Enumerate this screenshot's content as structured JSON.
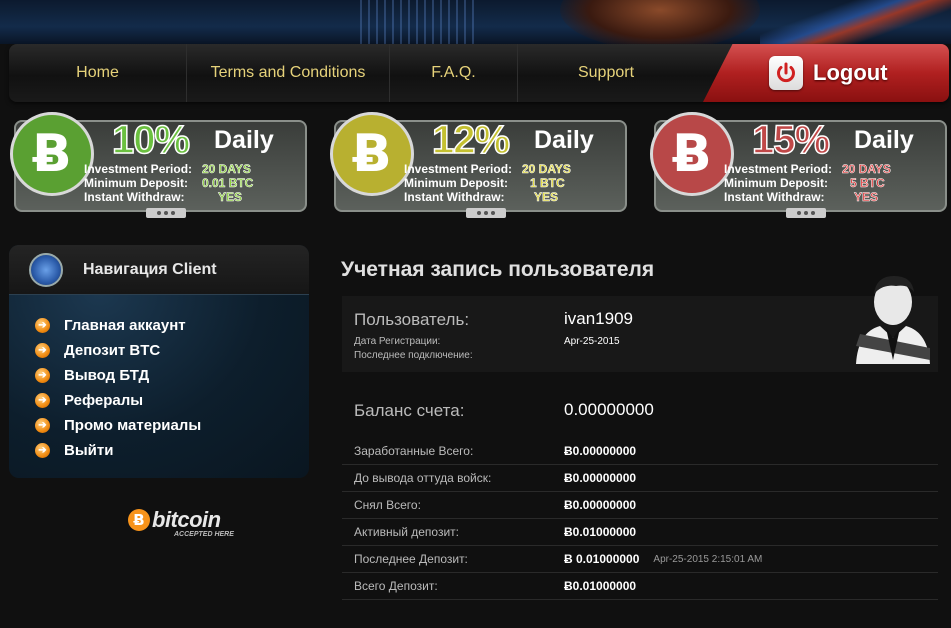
{
  "nav": {
    "home": "Home",
    "terms": "Terms and Conditions",
    "faq": "F.A.Q.",
    "support": "Support",
    "logout": "Logout"
  },
  "plans": [
    {
      "rate": "10%",
      "daily": "Daily",
      "color": "#5aa032",
      "rate_color": "#6bc040",
      "period_label": "Investment Period:",
      "period": "20 DAYS",
      "min_label": "Minimum Deposit:",
      "min": "0.01 BTC",
      "withdraw_label": "Instant Withdraw:",
      "withdraw": "YES"
    },
    {
      "rate": "12%",
      "daily": "Daily",
      "color": "#b8b030",
      "rate_color": "#c4c030",
      "period_label": "Investment Period:",
      "period": "20 DAYS",
      "min_label": "Minimum Deposit:",
      "min": "1 BTC",
      "withdraw_label": "Instant Withdraw:",
      "withdraw": "YES"
    },
    {
      "rate": "15%",
      "daily": "Daily",
      "color": "#b84848",
      "rate_color": "#c04848",
      "period_label": "Investment Period:",
      "period": "20 DAYS",
      "min_label": "Minimum Deposit:",
      "min": "5 BTC",
      "withdraw_label": "Instant Withdraw:",
      "withdraw": "YES"
    }
  ],
  "sidebar": {
    "title": "Навигация Client",
    "items": [
      {
        "label": "Главная аккаунт"
      },
      {
        "label": "Депозит BTC"
      },
      {
        "label": "Вывод БТД"
      },
      {
        "label": "Рефералы"
      },
      {
        "label": "Промо материалы"
      },
      {
        "label": "Выйти"
      }
    ]
  },
  "bitcoin_logo": {
    "word": "bitcoin",
    "tagline": "ACCEPTED HERE"
  },
  "main": {
    "title": "Учетная запись пользователя",
    "user_label": "Пользователь:",
    "username": "ivan1909",
    "reg_label": "Дата Регистрации:",
    "reg_date": "Apr-25-2015",
    "last_label": "Последнее подключение:",
    "balance_label": "Баланс счета:",
    "balance": "0.00000000",
    "stats": [
      {
        "label": "Заработанные Всего:",
        "value": "Ƀ0.00000000",
        "date": ""
      },
      {
        "label": "До вывода оттуда войск:",
        "value": "Ƀ0.00000000",
        "date": ""
      },
      {
        "label": "Снял Всего:",
        "value": "Ƀ0.00000000",
        "date": ""
      },
      {
        "label": "Активный депозит:",
        "value": "Ƀ0.01000000",
        "date": ""
      },
      {
        "label": "Последнее Депозит:",
        "value": "Ƀ 0.01000000",
        "date": "Apr-25-2015 2:15:01 AM"
      },
      {
        "label": "Всего Депозит:",
        "value": "Ƀ0.01000000",
        "date": ""
      }
    ]
  }
}
